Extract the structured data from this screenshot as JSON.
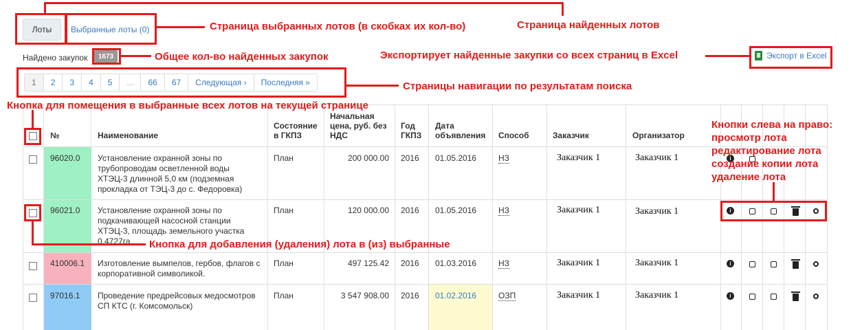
{
  "tabs": {
    "lots": "Лоты",
    "selected": "Выбранные лоты (0)"
  },
  "found_label": "Найдено закупок",
  "found_count": "1673",
  "export_label": "Экспорт в Excel",
  "pagination": [
    "1",
    "2",
    "3",
    "4",
    "5",
    "...",
    "66",
    "67",
    "Следующая ›",
    "Последняя »"
  ],
  "headers": {
    "num": "№",
    "name": "Наименование",
    "state": "Состояние в ГКПЗ",
    "price": "Начальная цена, руб. без НДС",
    "year": "Год ГКПЗ",
    "date": "Дата объявления",
    "method": "Способ",
    "customer": "Заказчик",
    "organizer": "Организатор"
  },
  "rows": [
    {
      "num": "96020.0",
      "name": [
        "Установление охранной зоны по",
        "трубопроводам осветленной воды",
        "ХТЭЦ-3 длинной 5,0 км (подземная",
        "прокладка от ТЭЦ-3 до с. Федоровка)"
      ],
      "state": "План",
      "price": "200 000.00",
      "year": "2016",
      "date": "01.05.2016",
      "method": "НЗ",
      "customer": "Заказчик 1",
      "organizer": "Заказчик 1",
      "color": "#9ff0c4"
    },
    {
      "num": "96021.0",
      "name": [
        "Установление охранной зоны по",
        "подкачивающей насосной станции",
        "ХТЭЦ-3, площадь земельного участка",
        "0,4727га"
      ],
      "state": "План",
      "price": "120 000.00",
      "year": "2016",
      "date": "01.05.2016",
      "method": "НЗ",
      "customer": "Заказчик 1",
      "organizer": "Заказчик 1",
      "color": "#9ff0c4"
    },
    {
      "num": "410006.1",
      "name": [
        "Изготовление вымпелов, гербов, флагов с",
        "корпоративной символикой."
      ],
      "state": "План",
      "price": "497 125.42",
      "year": "2016",
      "date": "01.03.2016",
      "method": "НЗ",
      "customer": "Заказчик 1",
      "organizer": "Заказчик 1",
      "color": "#f7b2be"
    },
    {
      "num": "97016.1",
      "name": [
        "Проведение предрейсовых медосмотров",
        "СП КТС (г. Комсомольск)"
      ],
      "state": "План",
      "price": "3 547 908.00",
      "year": "2016",
      "date": "01.02.2016",
      "method": "ОЗП",
      "customer": "Заказчик 1",
      "organizer": "Заказчик 1",
      "color": "#8fcbf5"
    }
  ],
  "annotations": {
    "selected_page": "Страница выбранных лотов (в скобках их кол-во)",
    "found_page": "Страница найденных лотов",
    "total_count": "Общее кол-во найденных закупок",
    "export": "Экспортирует найденные закупки со всех страниц в Excel",
    "pagination": "Страницы навигации по результатам поиска",
    "select_all": "Кнопка для помещения в выбранные всех лотов на текущей странице",
    "buttons": [
      "Кнопки слева на право:",
      "просмотр лота",
      "редактирование лота",
      "создание копии лота",
      "удаление лота"
    ],
    "add_remove": "Кнопка для добавления (удаления) лота в (из) выбранные"
  }
}
